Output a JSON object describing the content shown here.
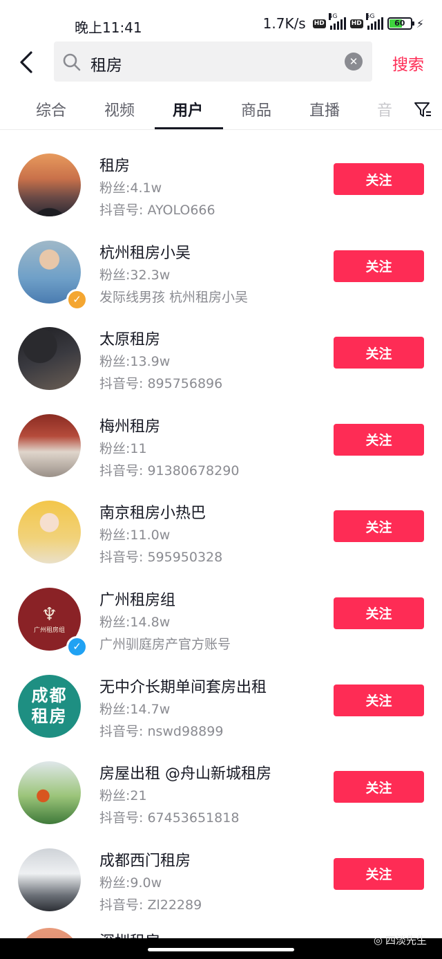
{
  "status_bar": {
    "time": "晚上11:41",
    "speed": "1.7K/s",
    "hd": "HD",
    "net1": "4G",
    "net2": "5G",
    "battery": "60"
  },
  "search": {
    "query": "租房",
    "button_label": "搜索"
  },
  "tabs": [
    {
      "label": "综合"
    },
    {
      "label": "视频"
    },
    {
      "label": "用户"
    },
    {
      "label": "商品"
    },
    {
      "label": "直播"
    },
    {
      "label": "音"
    }
  ],
  "users": [
    {
      "name": "租房",
      "fans": "粉丝:4.1w",
      "sub": "抖音号: AYOLO666",
      "follow": "关注"
    },
    {
      "name": "杭州租房小吴",
      "fans": "粉丝:32.3w",
      "sub": "发际线男孩   杭州租房小吴",
      "follow": "关注"
    },
    {
      "name": "太原租房",
      "fans": "粉丝:13.9w",
      "sub": "抖音号: 895756896",
      "follow": "关注"
    },
    {
      "name": "梅州租房",
      "fans": "粉丝:11",
      "sub": "抖音号: 91380678290",
      "follow": "关注"
    },
    {
      "name": "南京租房小热巴",
      "fans": "粉丝:11.0w",
      "sub": "抖音号: 595950328",
      "follow": "关注"
    },
    {
      "name": "广州租房组",
      "fans": "粉丝:14.8w",
      "sub": "广州驯庭房产官方账号",
      "follow": "关注"
    },
    {
      "name": "无中介长期单间套房出租",
      "fans": "粉丝:14.7w",
      "sub": "抖音号: nswd98899",
      "follow": "关注"
    },
    {
      "name": "房屋出租 @舟山新城租房",
      "fans": "粉丝:21",
      "sub": "抖音号: 67453651818",
      "follow": "关注"
    },
    {
      "name": "成都西门租房",
      "fans": "粉丝:9.0w",
      "sub": "抖音号: Zl22289",
      "follow": "关注"
    },
    {
      "name": "深圳租房"
    }
  ],
  "avatars": {
    "a6_text": "广州租房组",
    "a7_line1": "成都",
    "a7_line2": "租房"
  },
  "watermark": "四淡先生",
  "colors": {
    "accent": "#fe2c55",
    "verified_blue": "#20a2f3",
    "verified_orange": "#f4a631"
  }
}
